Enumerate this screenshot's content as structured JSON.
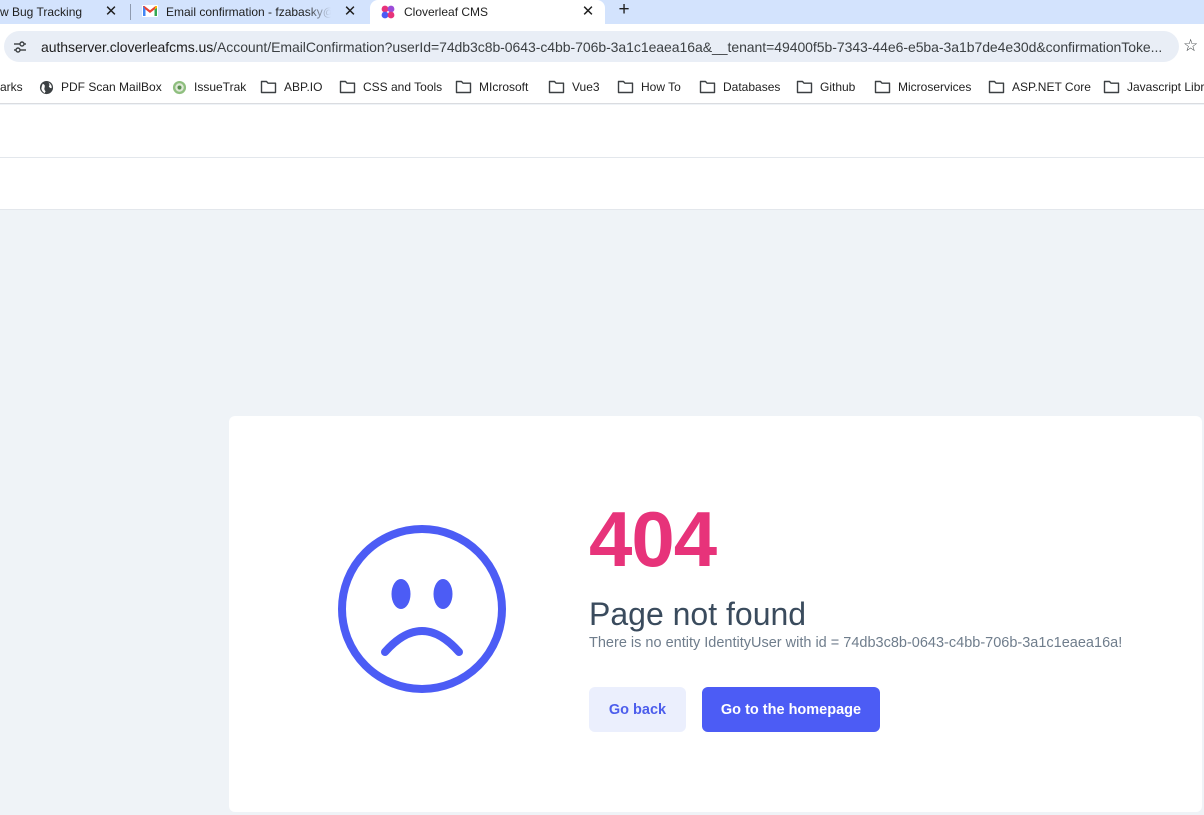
{
  "browser": {
    "tabs": [
      {
        "title": "w Bug Tracking",
        "active": false
      },
      {
        "title": "Email confirmation - fzabasky@",
        "favicon": "gmail-icon",
        "active": false
      },
      {
        "title": "Cloverleaf CMS",
        "favicon": "cloverleaf-icon",
        "active": true
      }
    ],
    "new_tab_label": "+",
    "close_glyph": "✕",
    "address": {
      "host": "authserver.cloverleafcms.us",
      "path": "/Account/EmailConfirmation?userId=74db3c8b-0643-c4bb-706b-3a1c1eaea16a&__tenant=49400f5b-7343-44e6-e5ba-3a1b7de4e30d&confirmationToke..."
    },
    "star_glyph": "☆",
    "bookmarks": [
      {
        "label": "arks",
        "icon": "none"
      },
      {
        "label": "PDF Scan MailBox",
        "icon": "globe-icon"
      },
      {
        "label": "IssueTrak",
        "icon": "issuetrak-icon"
      },
      {
        "label": "ABP.IO",
        "icon": "folder-icon"
      },
      {
        "label": "CSS and Tools",
        "icon": "folder-icon"
      },
      {
        "label": "MIcrosoft",
        "icon": "folder-icon"
      },
      {
        "label": "Vue3",
        "icon": "folder-icon"
      },
      {
        "label": "How To",
        "icon": "folder-icon"
      },
      {
        "label": "Databases",
        "icon": "folder-icon"
      },
      {
        "label": "Github",
        "icon": "folder-icon"
      },
      {
        "label": "Microservices",
        "icon": "folder-icon"
      },
      {
        "label": "ASP.NET Core",
        "icon": "folder-icon"
      },
      {
        "label": "Javascript Libra",
        "icon": "folder-icon"
      }
    ]
  },
  "error": {
    "code": "404",
    "title": "Page not found",
    "message": "There is no entity IdentityUser with id = 74db3c8b-0643-c4bb-706b-3a1c1eaea16a!",
    "back_label": "Go back",
    "home_label": "Go to the homepage"
  },
  "colors": {
    "accent": "#4c5cf5",
    "error_code": "#e7337a",
    "tabstrip": "#d3e3fd",
    "page_bg": "#eff3f7"
  }
}
